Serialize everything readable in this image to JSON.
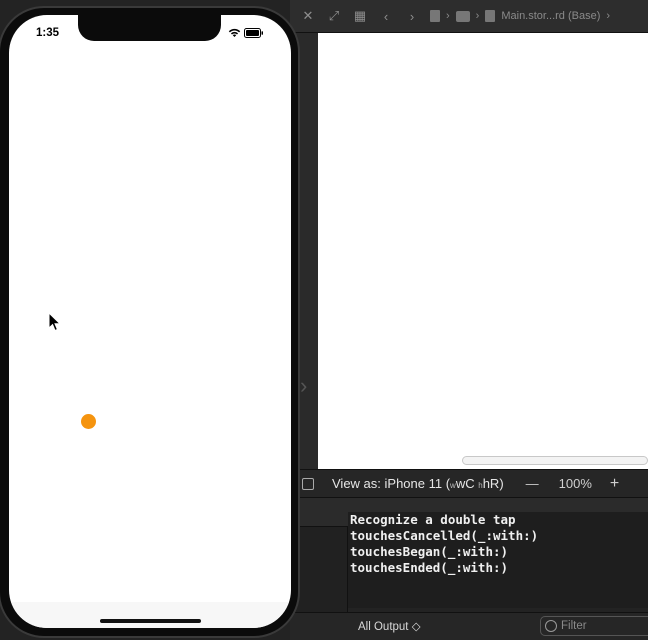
{
  "xcode": {
    "jump_bar_file": "Main.stor...rd (Base)",
    "view_as_label": "View as: iPhone 11",
    "size_w_label": "wC",
    "size_h_label": "hR",
    "zoom_minus": "—",
    "zoom_percent": "100%",
    "zoom_plus": "+",
    "console_lines": [
      "Recognize a double tap",
      "touchesCancelled(_:with:)",
      "touchesBegan(_:with:)",
      "touchesEnded(_:with:)"
    ],
    "output_selector": "All Output ◇",
    "filter_placeholder": "Filter"
  },
  "simulator": {
    "time": "1:35",
    "dot_color": "#f5940f"
  }
}
